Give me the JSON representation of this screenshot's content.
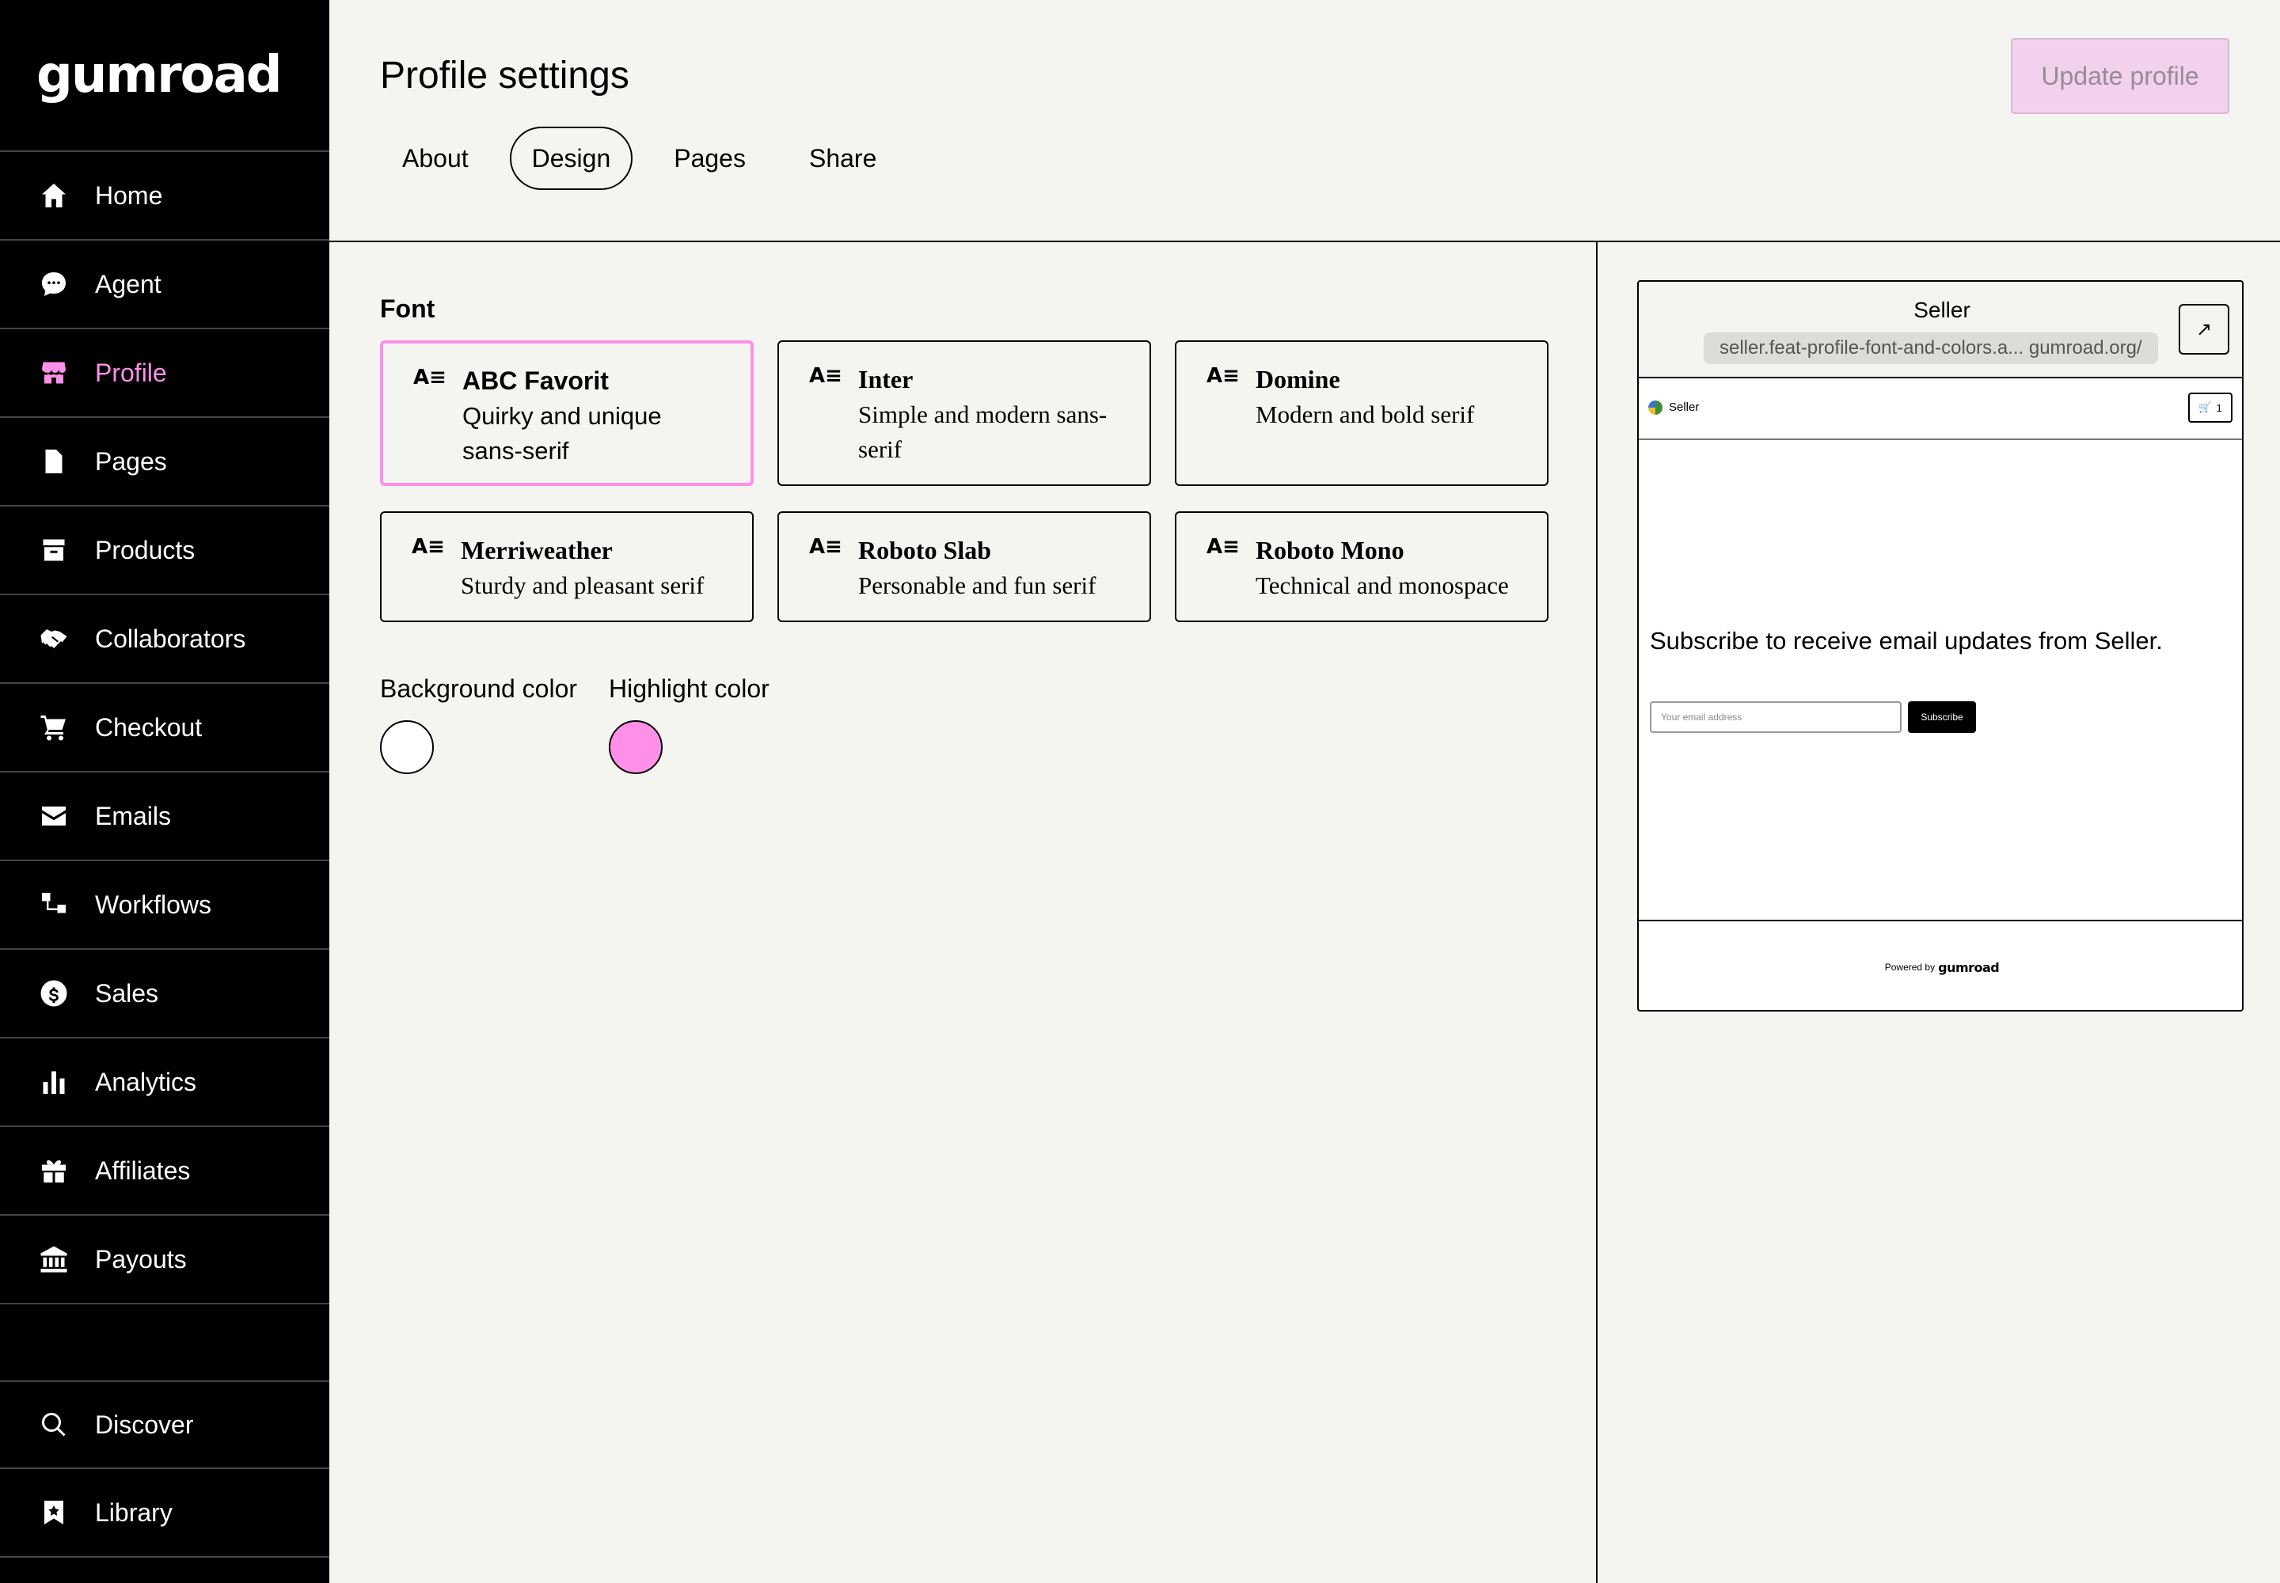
{
  "brand": "gumroad",
  "sidebar": {
    "items": [
      {
        "label": "Home",
        "icon": "home-icon"
      },
      {
        "label": "Agent",
        "icon": "chat-icon"
      },
      {
        "label": "Profile",
        "icon": "shop-icon",
        "active": true
      },
      {
        "label": "Pages",
        "icon": "document-icon"
      },
      {
        "label": "Products",
        "icon": "archive-icon"
      },
      {
        "label": "Collaborators",
        "icon": "handshake-icon"
      },
      {
        "label": "Checkout",
        "icon": "cart-icon"
      },
      {
        "label": "Emails",
        "icon": "envelope-icon"
      },
      {
        "label": "Workflows",
        "icon": "flow-icon"
      },
      {
        "label": "Sales",
        "icon": "dollar-icon"
      },
      {
        "label": "Analytics",
        "icon": "bar-chart-icon"
      },
      {
        "label": "Affiliates",
        "icon": "gift-icon"
      },
      {
        "label": "Payouts",
        "icon": "bank-icon"
      }
    ],
    "bottom_items": [
      {
        "label": "Discover",
        "icon": "search-icon"
      },
      {
        "label": "Library",
        "icon": "bookmark-icon"
      }
    ]
  },
  "header": {
    "title": "Profile settings",
    "update_button": "Update profile",
    "tabs": [
      "About",
      "Design",
      "Pages",
      "Share"
    ],
    "active_tab": "Design"
  },
  "design": {
    "font_label": "Font",
    "fonts": [
      {
        "name": "ABC Favorit",
        "desc": "Quirky and unique sans-serif",
        "selected": true
      },
      {
        "name": "Inter",
        "desc": "Simple and modern sans-serif"
      },
      {
        "name": "Domine",
        "desc": "Modern and bold serif"
      },
      {
        "name": "Merriweather",
        "desc": "Sturdy and pleasant serif"
      },
      {
        "name": "Roboto Slab",
        "desc": "Personable and fun serif"
      },
      {
        "name": "Roboto Mono",
        "desc": "Technical and monospace"
      }
    ],
    "background_color_label": "Background color",
    "highlight_color_label": "Highlight color",
    "background_color": "#ffffff",
    "highlight_color": "#ff90e8"
  },
  "preview": {
    "title": "Seller",
    "url": "seller.feat-profile-font-and-colors.a... gumroad.org/",
    "seller_name": "Seller",
    "cart_count": "1",
    "subscribe_text": "Subscribe to receive email updates from Seller.",
    "email_placeholder": "Your email address",
    "subscribe_button": "Subscribe",
    "powered_by": "Powered by",
    "powered_brand": "gumroad"
  }
}
